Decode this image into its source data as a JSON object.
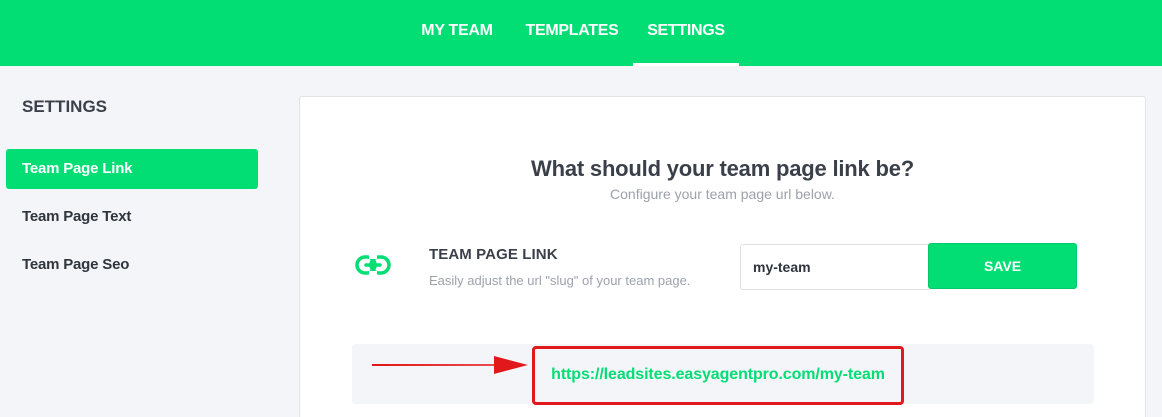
{
  "nav": {
    "tabs": [
      {
        "label": "MY TEAM"
      },
      {
        "label": "TEMPLATES"
      },
      {
        "label": "SETTINGS"
      }
    ],
    "active_tab": "SETTINGS"
  },
  "sidebar": {
    "title": "SETTINGS",
    "items": [
      {
        "label": "Team Page Link"
      },
      {
        "label": "Team Page Text"
      },
      {
        "label": "Team Page Seo"
      }
    ],
    "active_item": "Team Page Link"
  },
  "main": {
    "heading": "What should your team page link be?",
    "subheading": "Configure your team page url below.",
    "setting": {
      "icon": "link-icon",
      "title": "TEAM PAGE LINK",
      "description": "Easily adjust the url \"slug\" of your team page.",
      "slug_value": "my-team",
      "save_label": "SAVE"
    },
    "preview_url": "https://leadsites.easyagentpro.com/my-team"
  },
  "colors": {
    "brand": "#02dd74",
    "highlight": "#e2191b",
    "text": "#3a3f4a",
    "muted": "#9ca1ab"
  }
}
